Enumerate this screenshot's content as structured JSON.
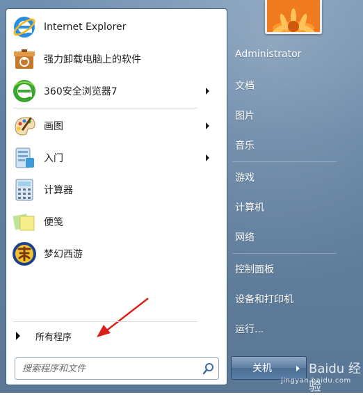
{
  "start_menu": {
    "pinned": [
      {
        "label": "Internet Explorer",
        "icon": "internet-explorer-icon",
        "submenu": false
      },
      {
        "label": "强力卸载电脑上的软件",
        "icon": "uninstaller-box-icon",
        "submenu": false
      },
      {
        "label": "360安全浏览器7",
        "icon": "360-browser-icon",
        "submenu": true
      }
    ],
    "recent": [
      {
        "label": "画图",
        "icon": "paint-palette-icon",
        "submenu": true
      },
      {
        "label": "入门",
        "icon": "getting-started-icon",
        "submenu": true
      },
      {
        "label": "计算器",
        "icon": "calculator-icon",
        "submenu": false
      },
      {
        "label": "便笺",
        "icon": "sticky-notes-icon",
        "submenu": false
      },
      {
        "label": "梦幻西游",
        "icon": "game-logo-icon",
        "submenu": false
      }
    ],
    "all_programs": "所有程序",
    "search_placeholder": "搜索程序和文件",
    "right_items": [
      "Administrator",
      "文档",
      "图片",
      "音乐",
      "游戏",
      "计算机",
      "网络",
      "控制面板",
      "设备和打印机",
      "运行..."
    ],
    "shutdown_label": "关机",
    "watermark_text": "Baidu 经验",
    "watermark_url": "jingyan.baidu.com"
  },
  "colors": {
    "accent_red": "#d9211b",
    "ie_blue": "#1e73c8",
    "panel_blue": "#5d7e9f"
  }
}
